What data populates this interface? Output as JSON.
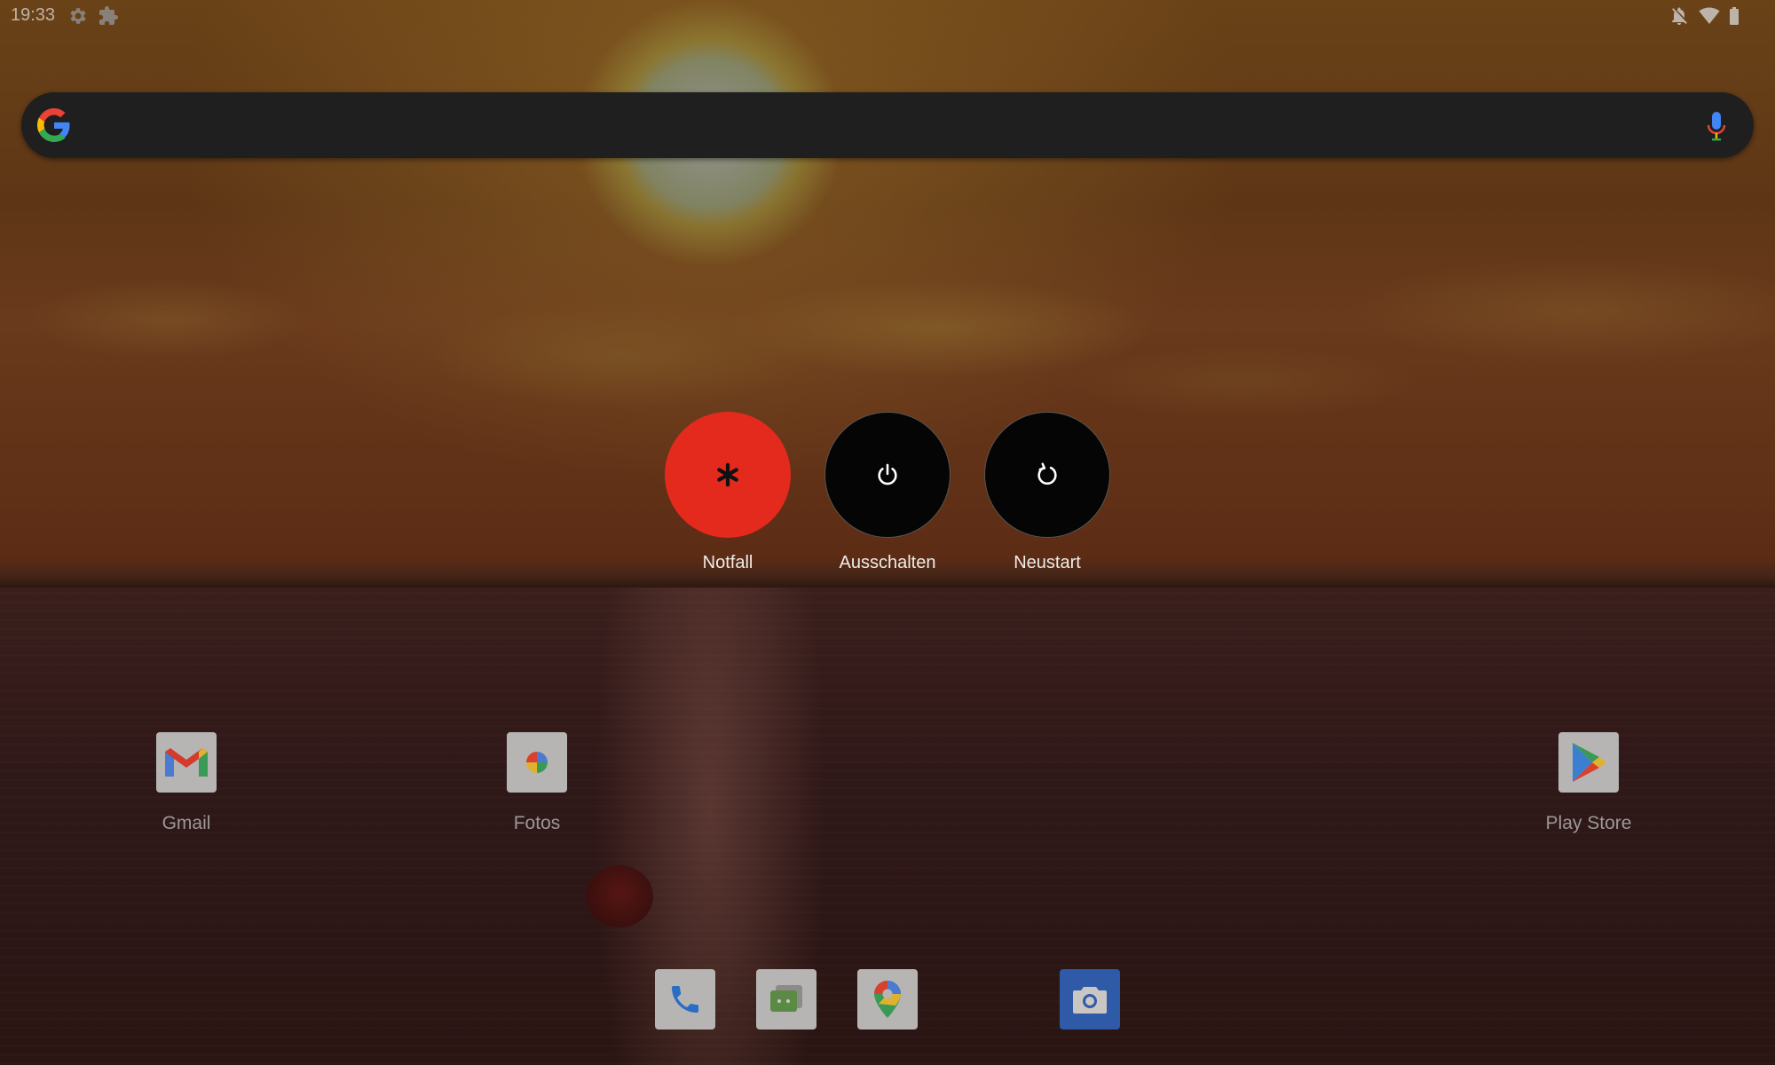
{
  "status_bar": {
    "time": "19:33",
    "left_icons": [
      "gear-icon",
      "puzzle-icon"
    ],
    "right_icons": [
      "notifications-off-icon",
      "wifi-icon",
      "battery-icon"
    ]
  },
  "search_bar": {
    "logo": "google-g-icon",
    "mic": "mic-icon"
  },
  "power_menu": {
    "items": [
      {
        "label": "Notfall",
        "icon": "asterisk-icon",
        "color": "#e42a1d"
      },
      {
        "label": "Ausschalten",
        "icon": "power-icon",
        "color": "#050505"
      },
      {
        "label": "Neustart",
        "icon": "restart-icon",
        "color": "#050505"
      }
    ]
  },
  "home_apps": [
    {
      "label": "Gmail",
      "icon": "gmail-icon"
    },
    {
      "label": "Fotos",
      "icon": "photos-icon"
    },
    {
      "label": "Play Store",
      "icon": "play-store-icon"
    }
  ],
  "dock": [
    {
      "icon": "phone-icon"
    },
    {
      "icon": "messages-icon"
    },
    {
      "icon": "maps-icon"
    },
    {
      "icon": "camera-icon"
    }
  ]
}
